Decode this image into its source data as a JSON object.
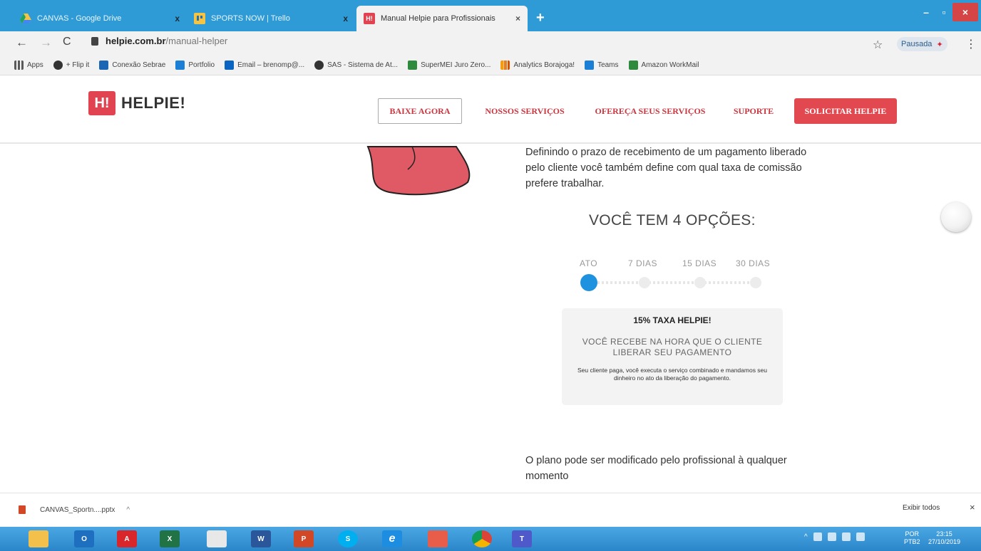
{
  "tabs": [
    {
      "title": "CANVAS - Google Drive",
      "close": "x"
    },
    {
      "title": "SPORTS NOW | Trello",
      "close": "x"
    },
    {
      "title": "Manual Helpie para Profissionais",
      "close": "×"
    }
  ],
  "new_tab": "+",
  "window_controls": {
    "minimize": "–",
    "maximize": "▫",
    "close": "×"
  },
  "address": {
    "domain": "helpie.com.br",
    "path": "/manual-helper"
  },
  "profile_status": "Pausada",
  "bookmarks": [
    {
      "label": "Apps",
      "color": "#666666"
    },
    {
      "label": "+ Flip it",
      "color": "#333333"
    },
    {
      "label": "Conexão Sebrae",
      "color": "#1b65b5"
    },
    {
      "label": "Portfolio",
      "color": "#1c7fd6"
    },
    {
      "label": "Email – brenomp@...",
      "color": "#0a64c2"
    },
    {
      "label": "SAS - Sistema de At...",
      "color": "#333333"
    },
    {
      "label": "SuperMEI Juro Zero...",
      "color": "#2e8b3e"
    },
    {
      "label": "Analytics Borajoga!",
      "color": "#f39c12"
    },
    {
      "label": "Teams",
      "color": "#1c7fd6"
    },
    {
      "label": "Amazon WorkMail",
      "color": "#2e8b3e"
    }
  ],
  "site": {
    "logo_mark": "H!",
    "logo_text": "HELPIE!",
    "nav": {
      "download": "BAIXE AGORA",
      "services": "NOSSOS SERVIÇOS",
      "offer": "OFEREÇA SEUS SERVIÇOS",
      "support": "SUPORTE",
      "request": "SOLICITAR HELPIE"
    },
    "brand_color": "#e2484f"
  },
  "content": {
    "intro": "Definindo o prazo de recebimento de um pagamento liberado pelo cliente você também define com qual taxa de comissão prefere trabalhar.",
    "options_title": "VOCÊ TEM 4 OPÇÕES:",
    "steps": [
      "ATO",
      "7 DIAS",
      "15 DIAS",
      "30 DIAS"
    ],
    "selected_step": "ATO",
    "card": {
      "title": "15% TAXA HELPIE!",
      "subtitle": "VOCÊ RECEBE NA HORA QUE O CLIENTE LIBERAR SEU PAGAMENTO",
      "detail": "Seu cliente paga, você executa o serviço combinado e mandamos seu dinheiro no ato da liberação do pagamento."
    },
    "footer_note": "O plano pode ser modificado pelo profissional à qualquer momento"
  },
  "download_bar": {
    "file": "CANVAS_Sportn....pptx",
    "show_all": "Exibir todos",
    "close": "×"
  },
  "taskbar": {
    "apps": [
      {
        "name": "explorer-icon",
        "label": "",
        "color": "#f3c14b"
      },
      {
        "name": "outlook-icon",
        "label": "O",
        "color": "#1f6fc1"
      },
      {
        "name": "acrobat-icon",
        "label": "A",
        "color": "#d9262b"
      },
      {
        "name": "excel-icon",
        "label": "X",
        "color": "#217346"
      },
      {
        "name": "app-grid-icon",
        "label": "",
        "color": "#e8e8e8"
      },
      {
        "name": "word-icon",
        "label": "W",
        "color": "#2b579a"
      },
      {
        "name": "powerpoint-icon",
        "label": "P",
        "color": "#d24726"
      },
      {
        "name": "skype-icon",
        "label": "S",
        "color": "#00aff0"
      },
      {
        "name": "ie-icon",
        "label": "e",
        "color": "#1c8de0"
      },
      {
        "name": "gallery-icon",
        "label": "",
        "color": "#e85d4a"
      },
      {
        "name": "chrome-icon",
        "label": "",
        "color": "#db4437"
      },
      {
        "name": "teams-icon",
        "label": "T",
        "color": "#5059c9"
      }
    ],
    "language": "POR",
    "layout": "PTB2",
    "time": "23:15",
    "date": "27/10/2019"
  }
}
